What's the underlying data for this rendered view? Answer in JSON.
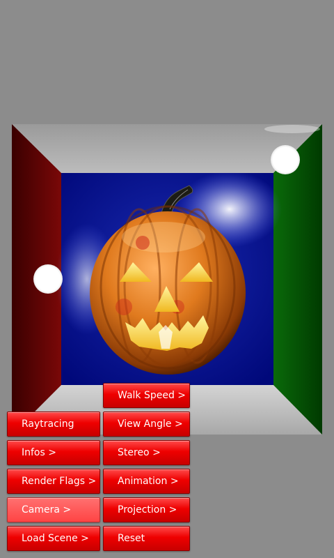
{
  "scene": {
    "colors": {
      "background": "#8c8c8c",
      "left_wall": "#5a0000",
      "right_wall": "#005500",
      "back_wall": "#00108c",
      "ceiling": "#a0a0a0",
      "floor": "#bdbdbd",
      "pumpkin": "#d9711a",
      "face_glow": "#ffd84a"
    }
  },
  "menu": {
    "accent": "#ee0000",
    "pressed_color": "#ff5050",
    "left": {
      "raytracing": "Raytracing",
      "infos": "Infos >",
      "render_flags": "Render Flags >",
      "camera": "Camera >",
      "load_scene": "Load Scene >"
    },
    "right": {
      "walk_speed": "Walk Speed >",
      "view_angle": "View Angle >",
      "stereo": "Stereo >",
      "animation": "Animation >",
      "projection": "Projection >",
      "reset": "Reset"
    }
  }
}
